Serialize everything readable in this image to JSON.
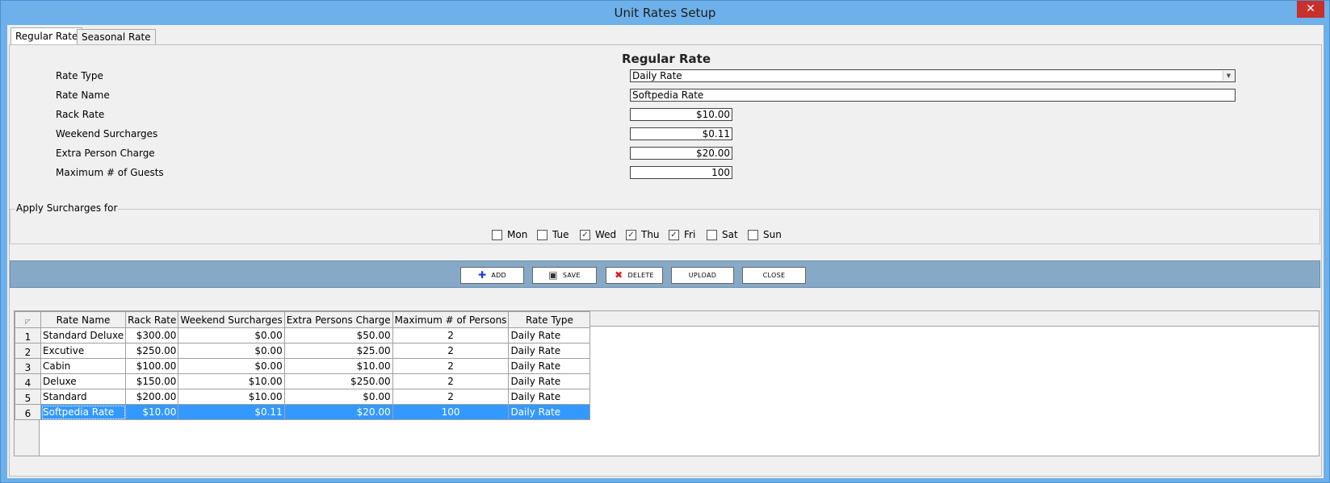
{
  "window": {
    "title": "Unit Rates Setup",
    "close_glyph": "✕"
  },
  "tabs": [
    {
      "label": "Regular Rate",
      "active": true
    },
    {
      "label": "Seasonal Rate",
      "active": false
    }
  ],
  "form": {
    "heading": "Regular Rate",
    "rate_type_label": "Rate Type",
    "rate_type_value": "Daily Rate",
    "rate_name_label": "Rate Name",
    "rate_name_value": "Softpedia Rate",
    "rack_rate_label": "Rack Rate",
    "rack_rate_value": "$10.00",
    "weekend_label": "Weekend Surcharges",
    "weekend_value": "$0.11",
    "extra_person_label": "Extra Person Charge",
    "extra_person_value": "$20.00",
    "max_guests_label": "Maximum # of Guests",
    "max_guests_value": "100"
  },
  "surcharges": {
    "legend": "Apply Surcharges for",
    "days": [
      {
        "label": "Mon",
        "checked": false
      },
      {
        "label": "Tue",
        "checked": false
      },
      {
        "label": "Wed",
        "checked": true
      },
      {
        "label": "Thu",
        "checked": true
      },
      {
        "label": "Fri",
        "checked": true
      },
      {
        "label": "Sat",
        "checked": false
      },
      {
        "label": "Sun",
        "checked": false
      }
    ]
  },
  "toolbar": {
    "add_label": "ADD",
    "save_label": "SAVE",
    "delete_label": "DELETE",
    "upload_label": "UPLOAD",
    "close_label": "CLOSE"
  },
  "grid": {
    "columns": [
      "Rate Name",
      "Rack Rate",
      "Weekend Surcharges",
      "Extra Persons Charge",
      "Maximum # of Persons",
      "Rate Type"
    ],
    "rows": [
      {
        "n": "1",
        "name": "Standard Deluxe",
        "rack": "$300.00",
        "weekend": "$0.00",
        "extra": "$50.00",
        "max": "2",
        "type": "Daily Rate"
      },
      {
        "n": "2",
        "name": "Excutive",
        "rack": "$250.00",
        "weekend": "$0.00",
        "extra": "$25.00",
        "max": "2",
        "type": "Daily Rate"
      },
      {
        "n": "3",
        "name": "Cabin",
        "rack": "$100.00",
        "weekend": "$0.00",
        "extra": "$10.00",
        "max": "2",
        "type": "Daily Rate"
      },
      {
        "n": "4",
        "name": "Deluxe",
        "rack": "$150.00",
        "weekend": "$10.00",
        "extra": "$250.00",
        "max": "2",
        "type": "Daily Rate"
      },
      {
        "n": "5",
        "name": "Standard",
        "rack": "$200.00",
        "weekend": "$10.00",
        "extra": "$0.00",
        "max": "2",
        "type": "Daily Rate"
      },
      {
        "n": "6",
        "name": "Softpedia Rate",
        "rack": "$10.00",
        "weekend": "$0.11",
        "extra": "$20.00",
        "max": "100",
        "type": "Daily Rate"
      }
    ],
    "selected_row": "6"
  }
}
